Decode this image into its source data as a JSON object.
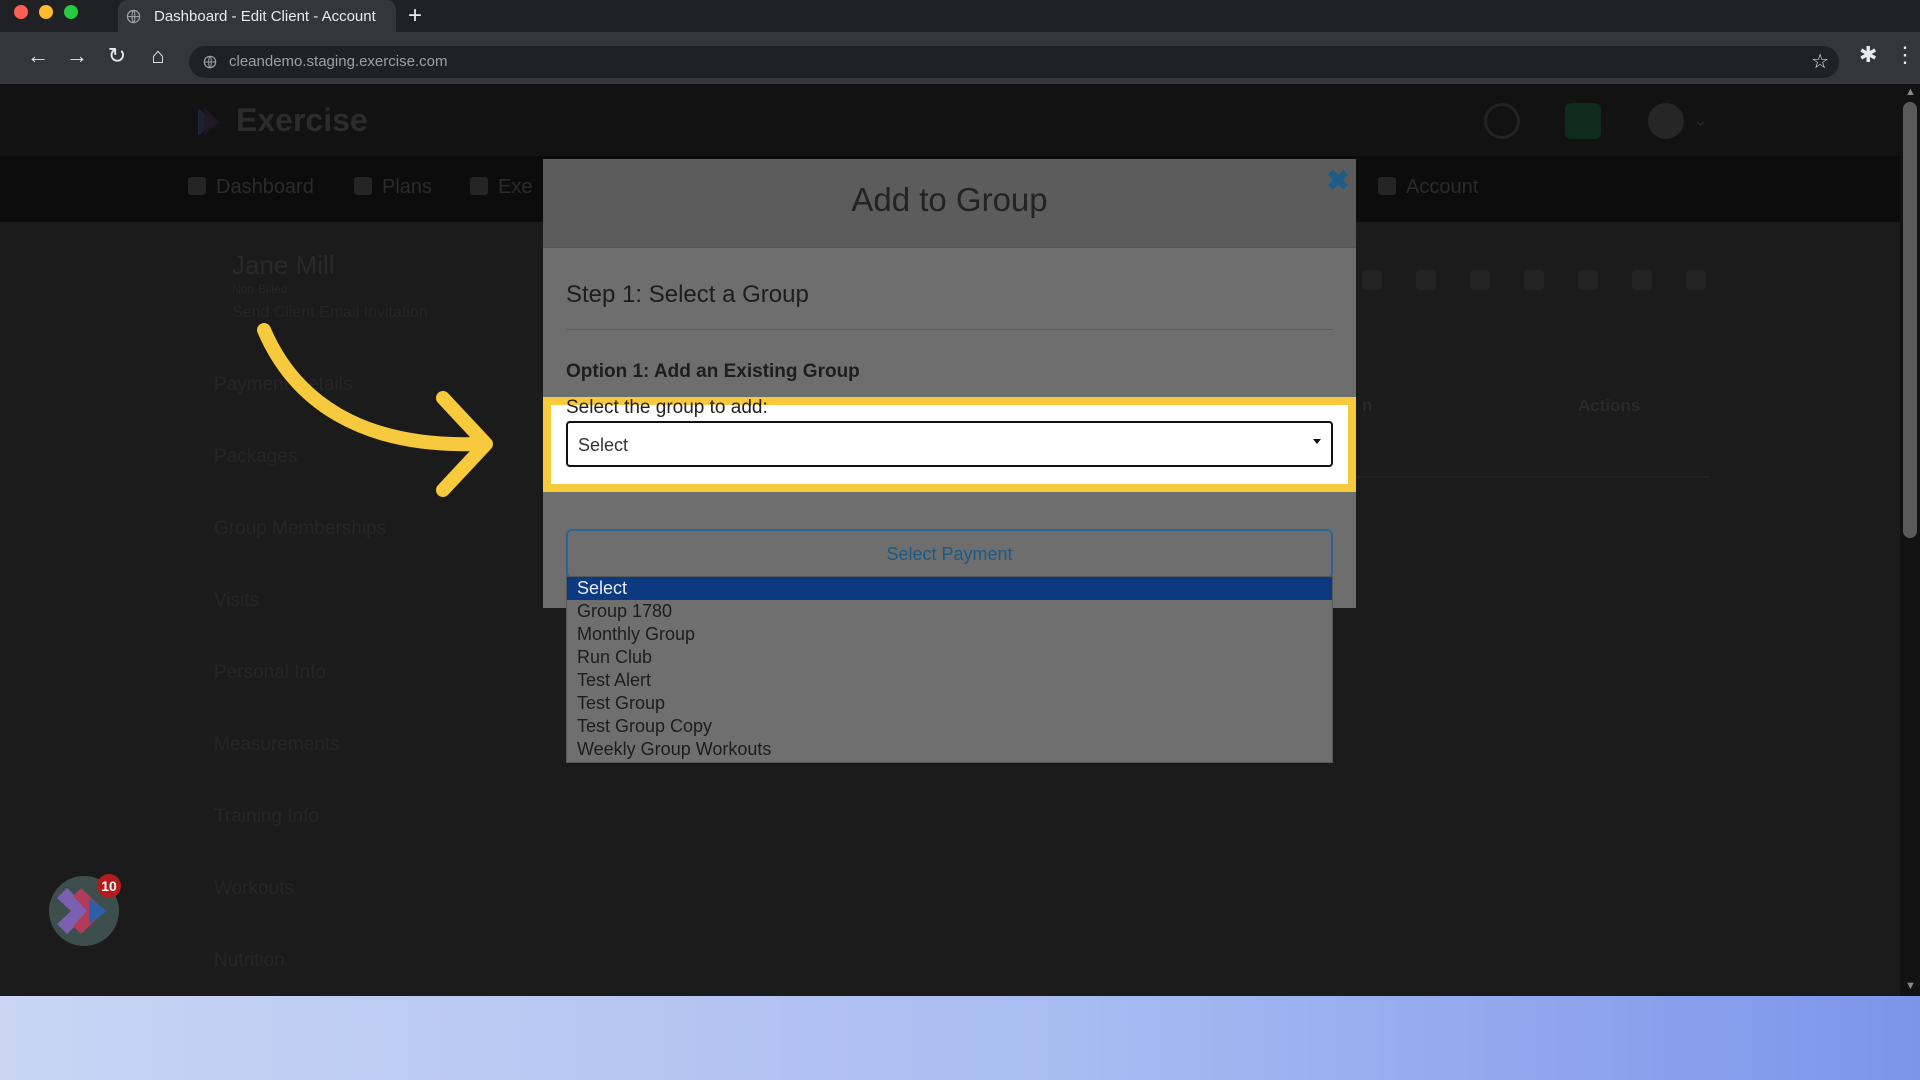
{
  "browser": {
    "tab_title": "Dashboard - Edit Client - Account",
    "url": "cleandemo.staging.exercise.com",
    "traffic_colors": [
      "#ff5f57",
      "#febc2e",
      "#28c840"
    ]
  },
  "app": {
    "brand": "Exercise",
    "nav": [
      "Dashboard",
      "Plans",
      "Exe",
      "Account"
    ],
    "client": {
      "name": "Jane Mill",
      "status": "Non-Billed",
      "link": "Send Client Email Invitation"
    },
    "sidebar": [
      "Payment Details",
      "Packages",
      "Group Memberships",
      "Visits",
      "Personal Info",
      "Measurements",
      "Training Info",
      "Workouts",
      "Nutrition"
    ],
    "table_headers": [
      "n",
      "Actions"
    ]
  },
  "modal": {
    "title": "Add to Group",
    "step": "Step 1: Select a Group",
    "option_title": "Option 1: Add an Existing Group",
    "select_label": "Select the group to add:",
    "select_value": "Select",
    "payment_button": "Select Payment",
    "options": [
      "Select",
      "Group 1780",
      "Monthly Group",
      "Run Club",
      "Test Alert",
      "Test Group",
      "Test Group Copy",
      "Weekly Group Workouts"
    ],
    "selected_index": 0
  },
  "widget": {
    "badge_count": "10"
  },
  "colors": {
    "highlight": "#f7c93c",
    "arrow": "#f7c93c",
    "accent": "#1e5d86",
    "selected_option": "#0b3a80"
  }
}
